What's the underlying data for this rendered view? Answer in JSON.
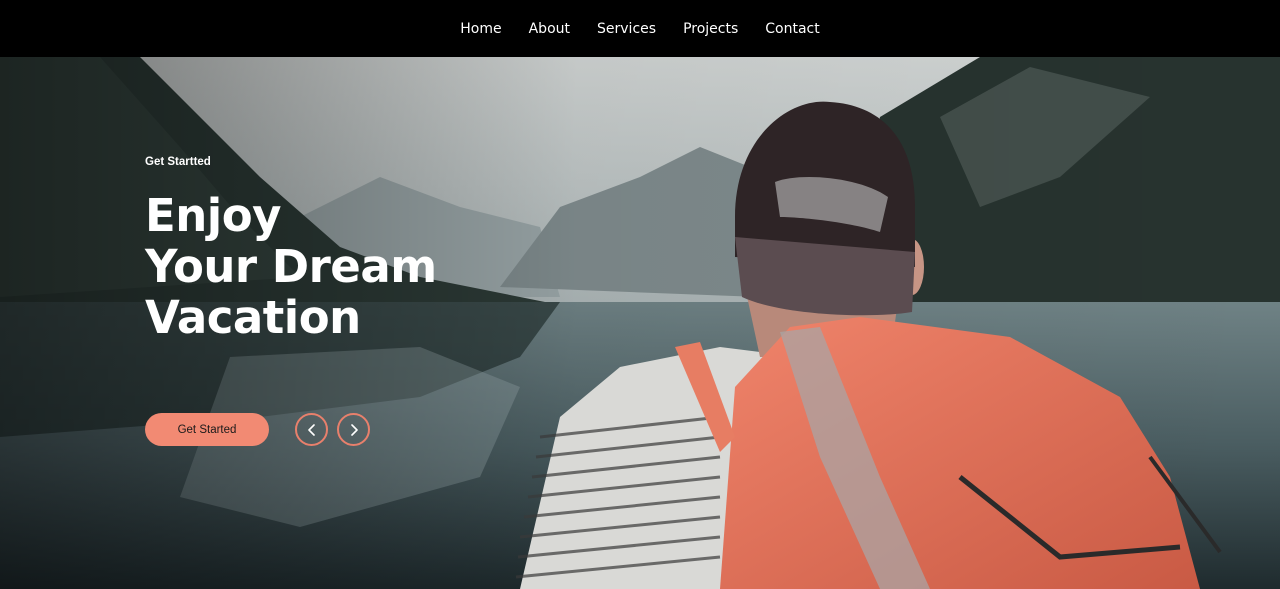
{
  "nav": {
    "items": [
      {
        "label": "Home"
      },
      {
        "label": "About"
      },
      {
        "label": "Services"
      },
      {
        "label": "Projects"
      },
      {
        "label": "Contact"
      }
    ]
  },
  "hero": {
    "eyebrow": "Get Startted",
    "headline_lines": [
      "Enjoy",
      "Your Dream",
      "Vacation"
    ],
    "cta_label": "Get Started",
    "prev_icon": "chevron-left-icon",
    "next_icon": "chevron-right-icon"
  },
  "colors": {
    "accent": "#f28a73",
    "nav_background": "#000000",
    "text": "#ffffff"
  }
}
